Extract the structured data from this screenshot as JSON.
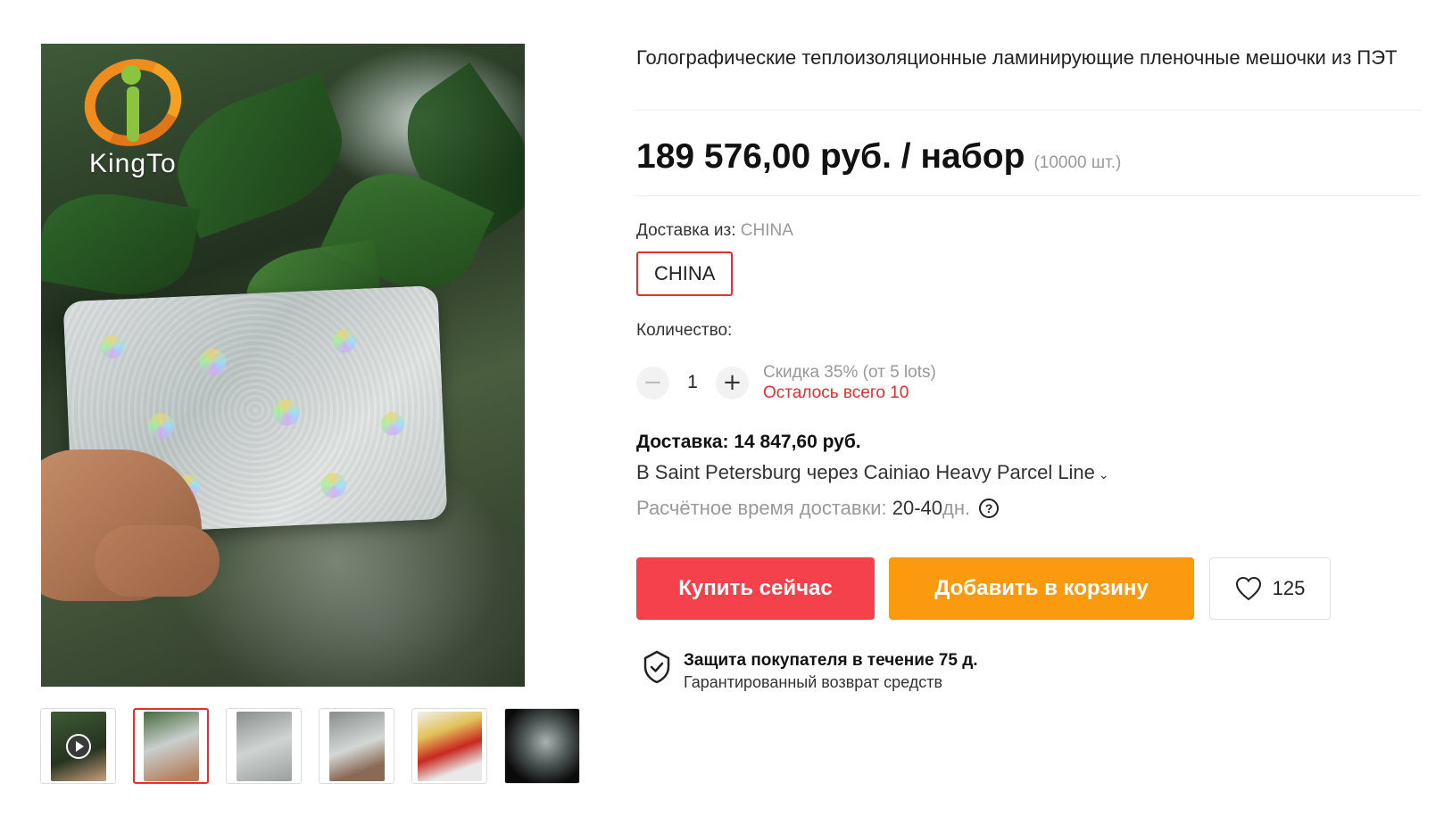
{
  "gallery": {
    "logo_text": "KingTo",
    "thumbnails": [
      {
        "name": "video"
      },
      {
        "name": "card-in-hand"
      },
      {
        "name": "card-front"
      },
      {
        "name": "card-held"
      },
      {
        "name": "package"
      },
      {
        "name": "dark-card"
      }
    ],
    "active_index": 1
  },
  "product": {
    "title": "Голографические теплоизоляционные ламинирующие пленочные мешочки из ПЭТ",
    "price": "189 576,00 руб. / набор",
    "price_unit": "(10000 шт.)"
  },
  "shipping": {
    "from_label": "Доставка из:",
    "from_value": "CHINA",
    "country_button": "CHINA"
  },
  "quantity": {
    "label": "Количество:",
    "value": "1",
    "minus": "−",
    "plus": "+",
    "discount": "Скидка 35% (от 5 lots)",
    "stock": "Осталось всего 10"
  },
  "delivery": {
    "title": "Доставка: 14 847,60 руб.",
    "route": "В Saint Petersburg через Cainiao Heavy Parcel Line",
    "time_label": "Расчётное время доставки:",
    "time_value": "20-40",
    "time_unit": "дн."
  },
  "actions": {
    "buy_now": "Купить сейчас",
    "add_to_cart": "Добавить в корзину",
    "wishlist_count": "125"
  },
  "protection": {
    "title": "Защита покупателя в течение 75 д.",
    "subtitle": "Гарантированный возврат средств"
  },
  "colors": {
    "accent_red": "#f5414b",
    "accent_orange": "#fb9a0e",
    "stock_red": "#e62e2e"
  }
}
